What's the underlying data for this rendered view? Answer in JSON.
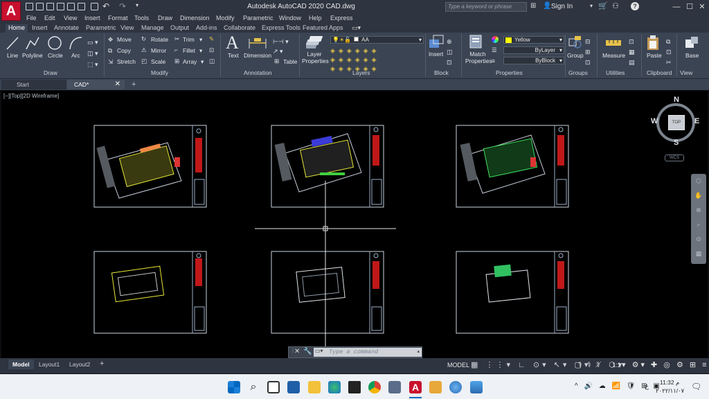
{
  "app": {
    "logo": "A",
    "title": "Autodesk AutoCAD 2020    CAD.dwg",
    "search_placeholder": "Type a keyword or phrase",
    "sign_in": "Sign In",
    "help": "?"
  },
  "menu": [
    "File",
    "Edit",
    "View",
    "Insert",
    "Format",
    "Tools",
    "Draw",
    "Dimension",
    "Modify",
    "Parametric",
    "Window",
    "Help",
    "Express"
  ],
  "ribbon_tabs": [
    "Home",
    "Insert",
    "Annotate",
    "Parametric",
    "View",
    "Manage",
    "Output",
    "Add-ins",
    "Collaborate",
    "Express Tools",
    "Featured Apps"
  ],
  "ribbon": {
    "draw": {
      "line": "Line",
      "polyline": "Polyline",
      "circle": "Circle",
      "arc": "Arc",
      "title": "Draw"
    },
    "modify": {
      "move": "Move",
      "rotate": "Rotate",
      "trim": "Trim",
      "copy": "Copy",
      "mirror": "Mirror",
      "fillet": "Fillet",
      "stretch": "Stretch",
      "scale": "Scale",
      "array": "Array",
      "title": "Modify"
    },
    "annotation": {
      "text": "Text",
      "dimension": "Dimension",
      "table": "Table",
      "title": "Annotation"
    },
    "layers": {
      "properties": "Layer Properties",
      "current": "AA",
      "title": "Layers"
    },
    "block": {
      "insert": "Insert",
      "title": "Block"
    },
    "properties": {
      "match": "Match Properties",
      "color": "Yellow",
      "linetype": "ByLayer",
      "lineweight": "ByBlock",
      "title": "Properties"
    },
    "groups": {
      "group": "Group",
      "title": "Groups"
    },
    "utilities": {
      "measure": "Measure",
      "title": "Utilities"
    },
    "clipboard": {
      "paste": "Paste",
      "title": "Clipboard"
    },
    "view": {
      "base": "Base",
      "title": "View"
    }
  },
  "doc_tabs": [
    "Start",
    "CAD*"
  ],
  "viewport_label": "[−][Top][2D Wireframe]",
  "viewcube": {
    "n": "N",
    "s": "S",
    "e": "E",
    "w": "W",
    "face": "TOP",
    "wcs": "WCS"
  },
  "command": {
    "placeholder": "Type a command"
  },
  "layout_tabs": [
    "Model",
    "Layout1",
    "Layout2"
  ],
  "status": {
    "model": "MODEL",
    "scale": "1:1"
  },
  "taskbar": {
    "time": "11:32 م",
    "date": "٢٠٢٢/١١/٠٧",
    "lang": "ع"
  },
  "colors": {
    "ribbon": "#3b4453",
    "titlebar": "#2e3440",
    "canvas": "#000000",
    "accent_red": "#c8102e",
    "yellow": "#ffff00"
  }
}
